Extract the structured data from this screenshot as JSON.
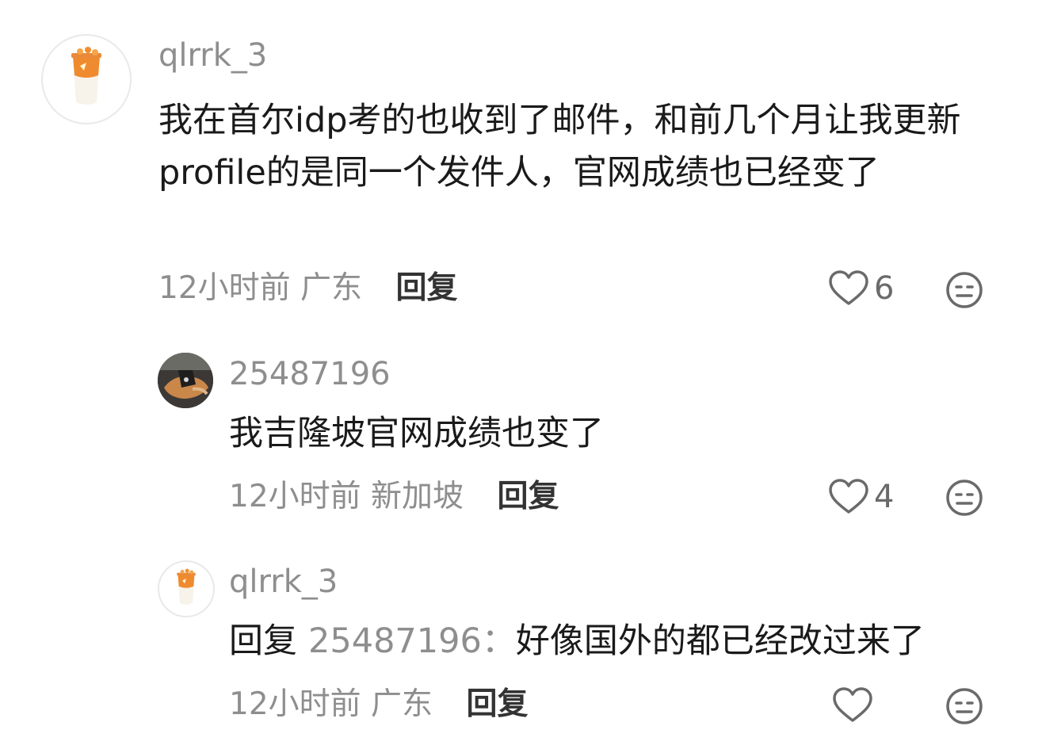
{
  "comments": [
    {
      "username": "qlrrk_3",
      "text": "我在首尔idp考的也收到了邮件，和前几个月让我更新profile的是同一个发件人，官网成绩也已经变了",
      "time": "12小时前",
      "location": "广东",
      "reply_label": "回复",
      "likes": "6"
    },
    {
      "username": "25487196",
      "text": "我吉隆坡官网成绩也变了",
      "time": "12小时前",
      "location": "新加坡",
      "reply_label": "回复",
      "likes": "4"
    },
    {
      "username": "qlrrk_3",
      "reply_prefix": "回复",
      "reply_to": "25487196：",
      "text": "好像国外的都已经改过来了",
      "time": "12小时前",
      "location": "广东",
      "reply_label": "回复",
      "likes": ""
    }
  ],
  "icons": {
    "like": "heart-outline-icon",
    "emoji": "neutral-face-icon",
    "avatar_user1": "orange-drink-cup",
    "avatar_user2": "hand-holding-food"
  },
  "colors": {
    "text_primary": "#1a1a1a",
    "text_secondary": "#8e8e8e",
    "icon": "#6a6a6a"
  }
}
